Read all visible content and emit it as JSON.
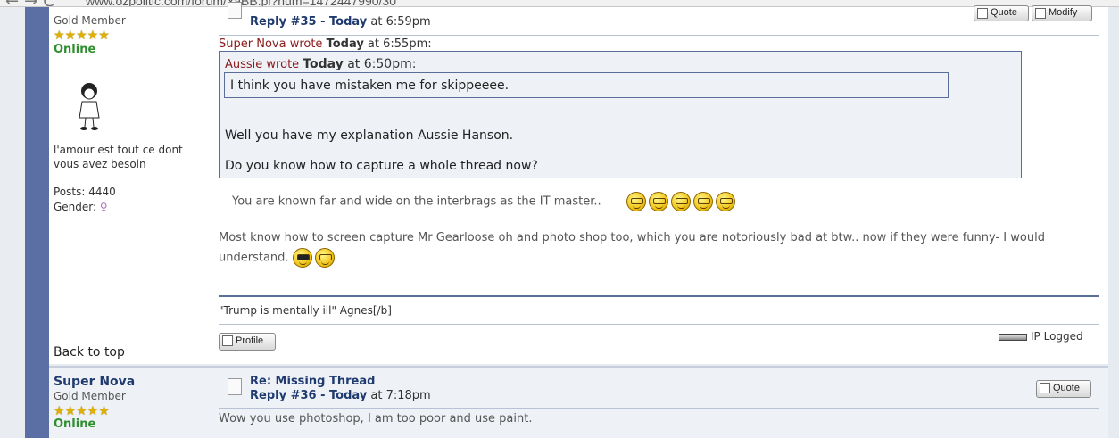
{
  "browser": {
    "url": "www.ozpolitic.com/forum/YaBB.pl?num=1472447990/30"
  },
  "post1": {
    "author_rank": "Gold Member",
    "status": "Online",
    "signature_text": "l'amour est tout ce dont vous avez besoin",
    "posts_label": "Posts: 4440",
    "gender_label": "Gender:",
    "back_to_top": "Back to top",
    "reply_label": "Reply #35 - ",
    "reply_today": "Today",
    "reply_time": " at 6:59pm",
    "quote_btn": "Quote",
    "modify_btn": "Modify",
    "outer_quote": {
      "author": "Super Nova wrote ",
      "today": "Today",
      "time": " at 6:55pm:"
    },
    "inner_quote": {
      "author": "Aussie wrote ",
      "today": "Today",
      "time": " at 6:50pm:",
      "text": "I think you have mistaken me for skippeeee."
    },
    "quote_para1": "Well you have my explanation Aussie Hanson.",
    "quote_para2": "Do you know how to capture a whole thread now?",
    "body_line1": "You are known far and wide on the interbrags as the IT master..",
    "body_line2": "Most know how to screen capture Mr Gearloose oh and photo shop too, which you are notoriously bad at btw.. now if they were funny- I would",
    "body_line3": "understand.",
    "signature": "\"Trump is mentally ill\" Agnes[/b]",
    "profile_btn": "Profile",
    "ip_logged": "IP Logged"
  },
  "post2": {
    "author_name": "Super Nova",
    "author_rank": "Gold Member",
    "status": "Online",
    "subject": "Re: Missing Thread",
    "reply_label": "Reply #36 - ",
    "reply_today": "Today",
    "reply_time": " at 7:18pm",
    "quote_btn": "Quote",
    "body": "Wow you use photoshop, I am too poor and use paint."
  },
  "colors": {
    "sidebar": "#5b6fa5",
    "link": "#1f3a6e",
    "online": "#2f8f2f",
    "quote_author": "#8b1a1a"
  },
  "icons": [
    "back-icon",
    "forward-icon",
    "reload-icon",
    "star-icon",
    "gender-female-icon",
    "post-icon",
    "smiley-icon",
    "cool-smiley-icon",
    "ip-logged-icon"
  ]
}
